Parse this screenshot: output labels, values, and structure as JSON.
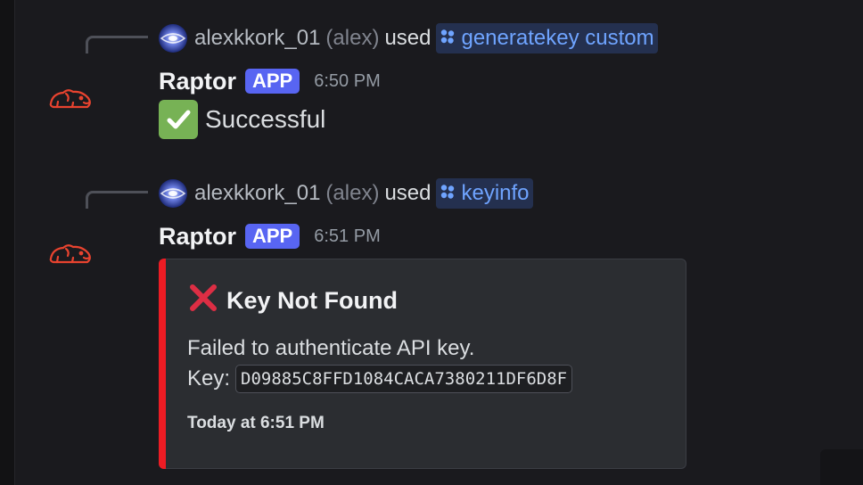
{
  "messages": [
    {
      "reply": {
        "username": "alexkkork_01",
        "nickname": "(alex)",
        "used_text": "used",
        "command": "generatekey custom"
      },
      "bot_name": "Raptor",
      "badge": "APP",
      "time": "6:50 PM",
      "content_text": "Successful",
      "content_icon": "check-mark-button-icon"
    },
    {
      "reply": {
        "username": "alexkkork_01",
        "nickname": "(alex)",
        "used_text": "used",
        "command": "keyinfo"
      },
      "bot_name": "Raptor",
      "badge": "APP",
      "time": "6:51 PM",
      "embed": {
        "title": "Key Not Found",
        "title_icon": "cross-mark-icon",
        "description_line1": "Failed to authenticate API key.",
        "key_label": "Key:",
        "key_value": "D09885C8FFD1084CACA7380211DF6D8F",
        "footer": "Today at 6:51 PM",
        "accent_color": "#ed1c24"
      }
    }
  ],
  "colors": {
    "background": "#1a1a1e",
    "app_badge": "#5865f2",
    "command_text": "#6fa4ff",
    "bot_avatar": "#e8432f"
  }
}
